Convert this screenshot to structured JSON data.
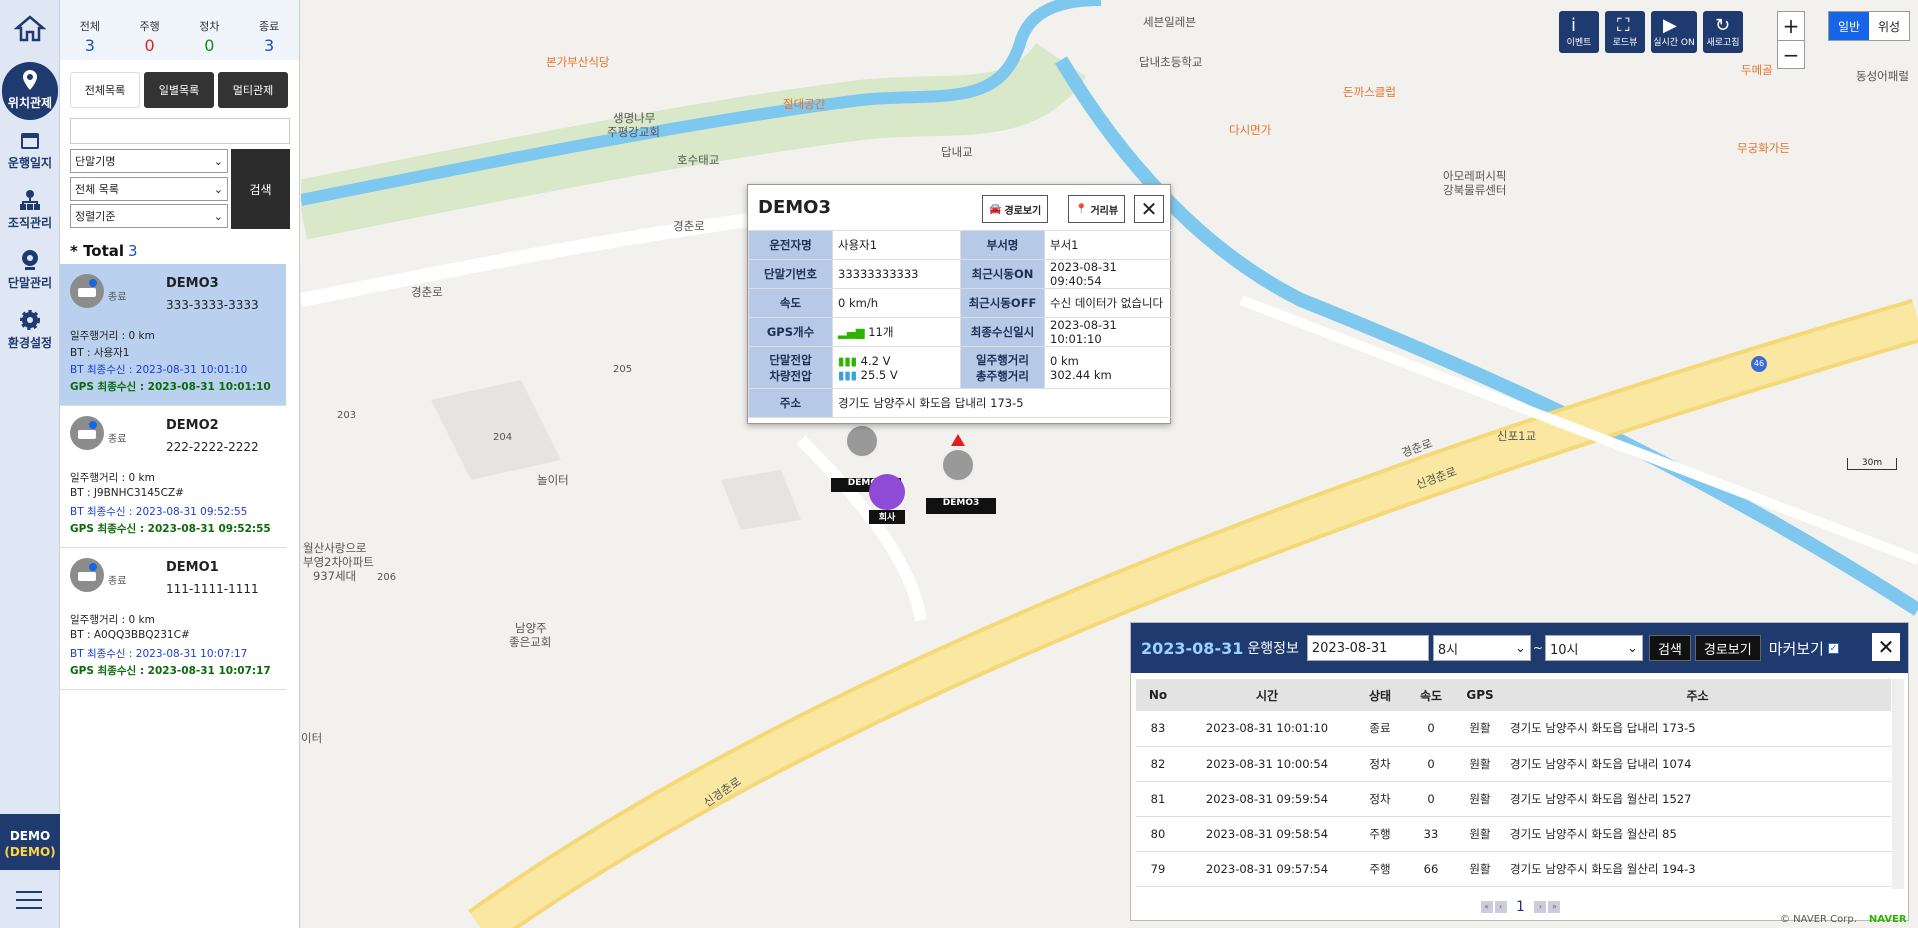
{
  "nav": {
    "items": [
      {
        "label": "위치관제",
        "icon": "location-icon"
      },
      {
        "label": "운행일지",
        "icon": "calendar-icon"
      },
      {
        "label": "조직관리",
        "icon": "org-chart-icon"
      },
      {
        "label": "단말관리",
        "icon": "device-icon"
      },
      {
        "label": "환경설정",
        "icon": "gear-icon"
      }
    ],
    "account_line1": "DEMO",
    "account_line2": "(DEMO)"
  },
  "counts": [
    {
      "label": "전체",
      "value": "3",
      "color": "#1a4fc9"
    },
    {
      "label": "주행",
      "value": "0",
      "color": "#e02020"
    },
    {
      "label": "정차",
      "value": "0",
      "color": "#1a8a1a"
    },
    {
      "label": "종료",
      "value": "3",
      "color": "#1a4fc9"
    }
  ],
  "tabs": [
    "전체목록",
    "일별목록",
    "멀티관제"
  ],
  "filters": {
    "search_placeholder": "",
    "select1": "단말기명",
    "select2": "전체 목록",
    "select3": "정렬기준",
    "search_button": "검색"
  },
  "total": {
    "label": "* Total",
    "value": "3"
  },
  "vehicles": [
    {
      "status": "종료",
      "name": "DEMO3",
      "phone": "333-3333-3333",
      "daily": "일주행거리 : 0 km",
      "bt": "BT : 사용자1",
      "bt_recv": "BT 최종수신 : 2023-08-31 10:01:10",
      "gps_recv": "GPS 최종수신 : 2023-08-31 10:01:10"
    },
    {
      "status": "종료",
      "name": "DEMO2",
      "phone": "222-2222-2222",
      "daily": "일주행거리 : 0 km",
      "bt": "BT : J9BNHC3145CZ#",
      "bt_recv": "BT 최종수신 : 2023-08-31 09:52:55",
      "gps_recv": "GPS 최종수신 : 2023-08-31 09:52:55"
    },
    {
      "status": "종료",
      "name": "DEMO1",
      "phone": "111-1111-1111",
      "daily": "일주행거리 : 0 km",
      "bt": "BT : A0QQ3BBQ231C#",
      "bt_recv": "BT 최종수신 : 2023-08-31 10:07:17",
      "gps_recv": "GPS 최종수신 : 2023-08-31 10:07:17"
    }
  ],
  "map": {
    "poi": [
      {
        "t": "세븐일레븐",
        "c": ""
      },
      {
        "t": "본가부산식당",
        "c": "or"
      },
      {
        "t": "절대공간",
        "c": "or"
      },
      {
        "t": "생명나무",
        "c": ""
      },
      {
        "t": "주평강교회",
        "c": ""
      },
      {
        "t": "호수태교",
        "c": ""
      },
      {
        "t": "답내교",
        "c": ""
      },
      {
        "t": "답내초등학교",
        "c": ""
      },
      {
        "t": "돈까스클럽",
        "c": "or"
      },
      {
        "t": "다시면가",
        "c": "or"
      },
      {
        "t": "두메골",
        "c": "or"
      },
      {
        "t": "동성어패럴",
        "c": ""
      },
      {
        "t": "무궁화가든",
        "c": "or"
      },
      {
        "t": "아모레퍼시픽",
        "c": ""
      },
      {
        "t": "강북물류센터",
        "c": ""
      },
      {
        "t": "경춘로",
        "c": ""
      },
      {
        "t": "경춘로",
        "c": ""
      },
      {
        "t": "205",
        "c": ""
      },
      {
        "t": "203",
        "c": ""
      },
      {
        "t": "204",
        "c": ""
      },
      {
        "t": "놀이터",
        "c": ""
      },
      {
        "t": "월산사랑으로",
        "c": ""
      },
      {
        "t": "부영2차아파트",
        "c": ""
      },
      {
        "t": "937세대",
        "c": ""
      },
      {
        "t": "206",
        "c": ""
      },
      {
        "t": "남양주",
        "c": ""
      },
      {
        "t": "좋은교회",
        "c": ""
      },
      {
        "t": "이터",
        "c": ""
      },
      {
        "t": "신포1교",
        "c": ""
      },
      {
        "t": "경춘로",
        "c": ""
      },
      {
        "t": "신경춘로",
        "c": ""
      },
      {
        "t": "신경춘로",
        "c": ""
      },
      {
        "t": "46",
        "c": ""
      }
    ],
    "top_buttons": [
      {
        "label": "이벤트",
        "icon": "info-icon",
        "glyph": "i"
      },
      {
        "label": "로드뷰",
        "icon": "roadview-icon",
        "glyph": "⛶"
      },
      {
        "label": "실시간 ON",
        "icon": "play-icon",
        "glyph": "▶"
      },
      {
        "label": "새로고침",
        "icon": "refresh-icon",
        "glyph": "↻"
      }
    ],
    "zoom_in": "+",
    "zoom_out": "−",
    "map_type": [
      "일반",
      "위성"
    ],
    "scale": "30m",
    "markers": [
      "DEMO1",
      "DEMO3",
      "회사"
    ],
    "copyright": "© NAVER Corp.",
    "brand": "NAVER"
  },
  "popup": {
    "title": "DEMO3",
    "route_btn": "경로보기",
    "street_btn": "거리뷰",
    "close": "✕",
    "rows": [
      {
        "h1": "운전자명",
        "v1": "사용자1",
        "h2": "부서명",
        "v2": "부서1"
      },
      {
        "h1": "단말기번호",
        "v1": "33333333333",
        "h2": "최근시동ON",
        "v2": "2023-08-31 09:40:54"
      },
      {
        "h1": "속도",
        "v1": "0 km/h",
        "h2": "최근시동OFF",
        "v2": "수신 데이터가 없습니다"
      },
      {
        "h1": "GPS개수",
        "v1": "11개",
        "h2": "최종수신일시",
        "v2": "2023-08-31 10:01:10"
      }
    ],
    "volt": {
      "h1a": "단말전압",
      "h1b": "차량전압",
      "v1a": "4.2 V",
      "v1b": "25.5 V",
      "h2a": "일주행거리",
      "h2b": "총주행거리",
      "v2a": "0 km",
      "v2b": "302.44 km"
    },
    "addr_h": "주소",
    "addr_v": "경기도 남양주시 화도읍 답내리 173-5"
  },
  "ops": {
    "date": "2023-08-31",
    "title": "운행정보",
    "date_input": "2023-08-31",
    "from": "8시",
    "tilde": "~",
    "to": "10시",
    "search": "검색",
    "route": "경로보기",
    "markers": "마커보기",
    "close": "✕",
    "columns": [
      "No",
      "시간",
      "상태",
      "속도",
      "GPS",
      "주소"
    ],
    "rows": [
      [
        "83",
        "2023-08-31 10:01:10",
        "종료",
        "0",
        "원활",
        "경기도 남양주시 화도읍 답내리 173-5"
      ],
      [
        "82",
        "2023-08-31 10:00:54",
        "정차",
        "0",
        "원활",
        "경기도 남양주시 화도읍 답내리 1074"
      ],
      [
        "81",
        "2023-08-31 09:59:54",
        "정차",
        "0",
        "원활",
        "경기도 남양주시 화도읍 월산리 1527"
      ],
      [
        "80",
        "2023-08-31 09:58:54",
        "주행",
        "33",
        "원활",
        "경기도 남양주시 화도읍 월산리 85"
      ],
      [
        "79",
        "2023-08-31 09:57:54",
        "주행",
        "66",
        "원활",
        "경기도 남양주시 화도읍 월산리 194-3"
      ]
    ],
    "page": "1"
  }
}
